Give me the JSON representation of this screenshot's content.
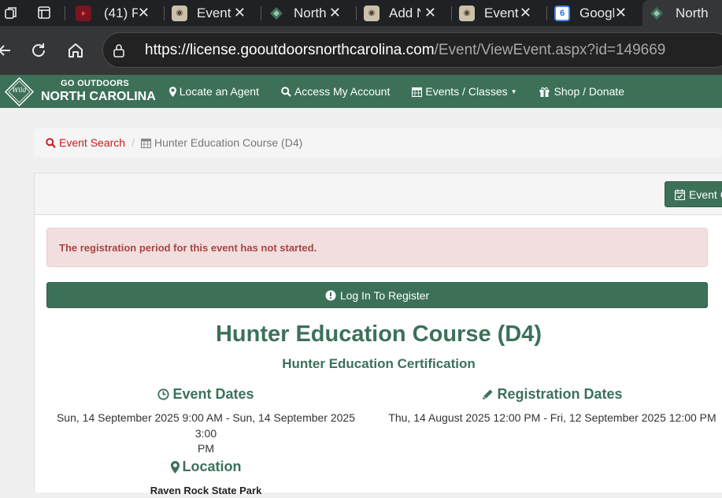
{
  "browser": {
    "tabs": [
      {
        "label": "(41) Fi",
        "icon": "youtube-icon"
      },
      {
        "label": "Events",
        "icon": "seal-icon"
      },
      {
        "label": "North",
        "icon": "diamond-logo-icon"
      },
      {
        "label": "Add N",
        "icon": "seal-icon"
      },
      {
        "label": "Events",
        "icon": "seal-icon"
      },
      {
        "label": "Googl",
        "icon": "google-calendar-icon",
        "badge": "6"
      },
      {
        "label": "North",
        "icon": "diamond-logo-icon",
        "active": true
      }
    ],
    "url_host": "https://license.gooutdoorsnorthcarolina.com",
    "url_path": "/Event/ViewEvent.aspx?id=149669"
  },
  "site": {
    "brand_top": "GO OUTDOORS",
    "brand_bottom": "NORTH CAROLINA",
    "logo_text": "Wild",
    "nav": {
      "agent": "Locate an Agent",
      "account": "Access My Account",
      "events": "Events / Classes",
      "shop": "Shop / Donate"
    },
    "accent_color": "#3c7158"
  },
  "breadcrumb": {
    "search": "Event Search",
    "current": "Hunter Education Course (D4)"
  },
  "panel": {
    "event_button": "Event C",
    "alert": "The registration period for this event has not started.",
    "login_button": "Log In To Register",
    "title": "Hunter Education Course (D4)",
    "subtitle": "Hunter Education Certification",
    "event_dates_heading": "Event Dates",
    "event_dates_line1": "Sun, 14 September 2025 9:00 AM - Sun, 14 September 2025 3:00",
    "event_dates_line2": "PM",
    "registration_heading": "Registration Dates",
    "registration_dates": "Thu, 14 August 2025 12:00 PM - Fri, 12 September 2025 12:00 PM",
    "location_heading": "Location",
    "location_name": "Raven Rock State Park"
  }
}
